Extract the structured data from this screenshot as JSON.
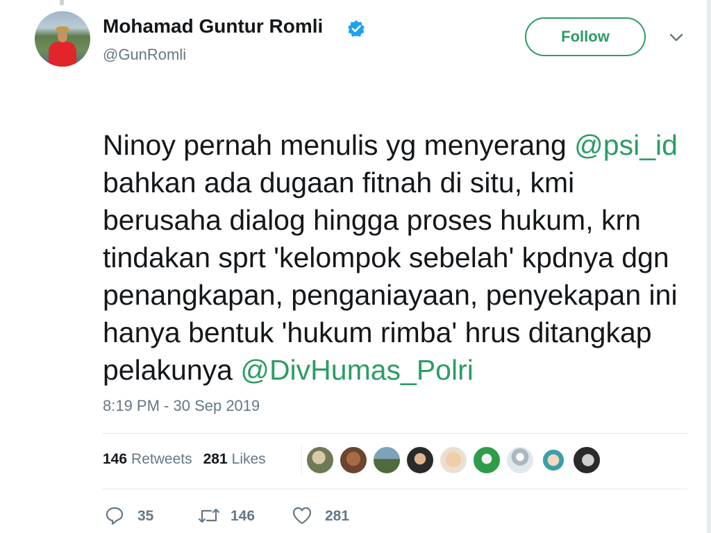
{
  "user": {
    "display_name": "Mohamad Guntur Romli",
    "handle": "@GunRomli",
    "verified": true,
    "avatar_icon": "profile-photo"
  },
  "follow_button": {
    "label": "Follow"
  },
  "menu": {
    "icon": "chevron-down-icon"
  },
  "tweet": {
    "parts": [
      {
        "type": "text",
        "value": "Ninoy pernah menulis yg menyerang "
      },
      {
        "type": "mention",
        "value": "@psi_id"
      },
      {
        "type": "text",
        "value": " bahkan ada dugaan fitnah di situ, kmi berusaha dialog hingga proses hukum, krn tindakan sprt 'kelompok sebelah' kpdnya dgn penangkapan, penganiayaan, penyekapan ini hanya bentuk 'hukum rimba' hrus ditangkap pelakunya "
      },
      {
        "type": "mention",
        "value": "@DivHumas_Polri"
      }
    ],
    "timestamp": "8:19 PM - 30 Sep 2019"
  },
  "stats": {
    "retweets": {
      "count": "146",
      "label": "Retweets"
    },
    "likes": {
      "count": "281",
      "label": "Likes"
    }
  },
  "actions": {
    "reply": {
      "count": "35",
      "icon": "reply-icon"
    },
    "retweet": {
      "count": "146",
      "icon": "retweet-icon"
    },
    "like": {
      "count": "281",
      "icon": "heart-icon"
    }
  },
  "colors": {
    "accent": "#2c9c64",
    "secondary_text": "#657786",
    "verified": "#1da1f2"
  }
}
